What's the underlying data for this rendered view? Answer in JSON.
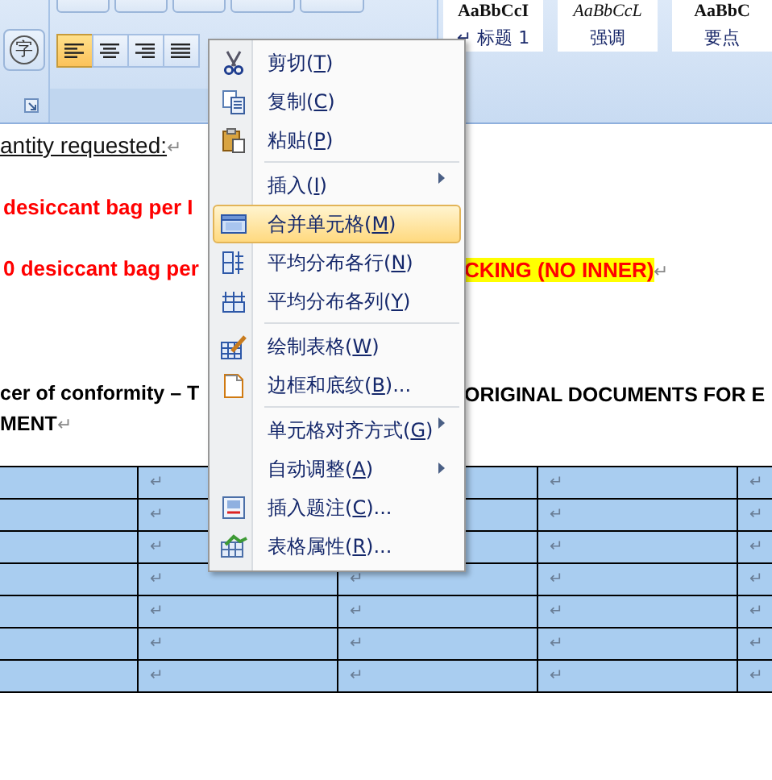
{
  "ribbon": {
    "phonetic_button": "字",
    "align_buttons": [
      {
        "kind": "left",
        "selected": true
      },
      {
        "kind": "center",
        "selected": false
      },
      {
        "kind": "right",
        "selected": false
      },
      {
        "kind": "justify",
        "selected": false
      }
    ],
    "styles": [
      {
        "kind": "heading",
        "preview": "AaBbCcI",
        "label": "↵ 标题 1"
      },
      {
        "kind": "emphasis",
        "preview": "AaBbCcL",
        "label": "强调"
      },
      {
        "kind": "strong",
        "preview": "AaBbC",
        "label": "要点"
      }
    ]
  },
  "document": {
    "lines": [
      {
        "left": [
          {
            "kind": "underlined",
            "text": "antity requested:"
          },
          {
            "kind": "mark",
            "text": "↵"
          }
        ]
      },
      {
        "left": [
          {
            "kind": "red",
            "text": " desiccant bag per I"
          }
        ]
      },
      {
        "left": [
          {
            "kind": "red",
            "text": "0 desiccant bag per"
          }
        ],
        "right": [
          {
            "kind": "red-highlight",
            "text": "CKING (NO INNER)"
          },
          {
            "kind": "mark",
            "text": "↵"
          }
        ]
      },
      {
        "left": [
          {
            "kind": "bold",
            "text": "cer of conformity – T"
          }
        ],
        "right": [
          {
            "kind": "bold",
            "text": "ORIGINAL DOCUMENTS FOR E"
          }
        ]
      },
      {
        "left": [
          {
            "kind": "bold",
            "text": "MENT"
          },
          {
            "kind": "mark",
            "text": "↵"
          }
        ]
      }
    ]
  },
  "table": {
    "rows": [
      [
        null,
        "↵",
        null,
        "↵",
        "↵"
      ],
      [
        null,
        "↵",
        null,
        "↵",
        "↵"
      ],
      [
        null,
        "↵",
        null,
        "↵",
        "↵"
      ],
      [
        null,
        "↵",
        "↵",
        "↵",
        "↵"
      ],
      [
        null,
        "↵",
        "↵",
        "↵",
        "↵"
      ],
      [
        null,
        "↵",
        "↵",
        "↵",
        "↵"
      ],
      [
        null,
        "↵",
        "↵",
        "↵",
        "↵"
      ]
    ]
  },
  "context_menu": {
    "items": [
      {
        "kind": "scissors",
        "before": "剪切(",
        "key": "T",
        "after": ")",
        "submenu": false,
        "highlighted": false,
        "separator_before": false
      },
      {
        "kind": "copy",
        "before": "复制(",
        "key": "C",
        "after": ")",
        "submenu": false,
        "highlighted": false,
        "separator_before": false
      },
      {
        "kind": "paste",
        "before": "粘贴(",
        "key": "P",
        "after": ")",
        "submenu": false,
        "highlighted": false,
        "separator_before": false
      },
      {
        "kind": "text",
        "before": "插入(",
        "key": "I",
        "after": ")",
        "submenu": true,
        "highlighted": false,
        "separator_before": true
      },
      {
        "kind": "merge",
        "before": "合并单元格(",
        "key": "M",
        "after": ")",
        "submenu": false,
        "highlighted": true,
        "separator_before": false
      },
      {
        "kind": "rows",
        "before": "平均分布各行(",
        "key": "N",
        "after": ")",
        "submenu": false,
        "highlighted": false,
        "separator_before": false
      },
      {
        "kind": "cols",
        "before": "平均分布各列(",
        "key": "Y",
        "after": ")",
        "submenu": false,
        "highlighted": false,
        "separator_before": false
      },
      {
        "kind": "draw",
        "before": "绘制表格(",
        "key": "W",
        "after": ")",
        "submenu": false,
        "highlighted": false,
        "separator_before": true
      },
      {
        "kind": "borders",
        "before": "边框和底纹(",
        "key": "B",
        "after": ")...",
        "submenu": false,
        "highlighted": false,
        "separator_before": false
      },
      {
        "kind": "text",
        "before": "单元格对齐方式(",
        "key": "G",
        "after": ")",
        "submenu": true,
        "highlighted": false,
        "separator_before": true
      },
      {
        "kind": "text",
        "before": "自动调整(",
        "key": "A",
        "after": ")",
        "submenu": true,
        "highlighted": false,
        "separator_before": false
      },
      {
        "kind": "caption",
        "before": "插入题注(",
        "key": "C",
        "after": ")...",
        "submenu": false,
        "highlighted": false,
        "separator_before": false
      },
      {
        "kind": "properties",
        "before": "表格属性(",
        "key": "R",
        "after": ")...",
        "submenu": false,
        "highlighted": false,
        "separator_before": false
      }
    ]
  }
}
